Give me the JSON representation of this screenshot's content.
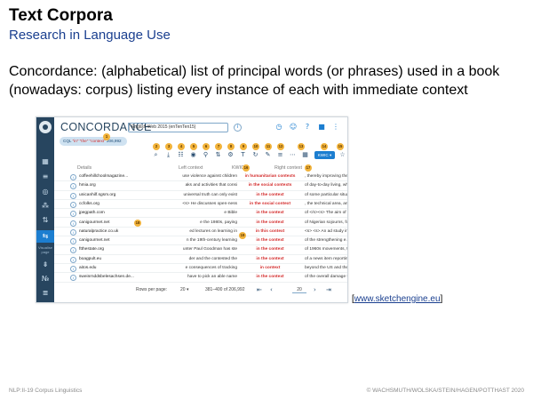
{
  "slide": {
    "title": "Text Corpora",
    "subtitle": "Research in Language Use",
    "body": "Concordance: (alphabetical) list of principal words (or phrases) used in a book (nowadays: corpus) listing every instance of each with immediate context",
    "source_link": "www.sketchengine.eu",
    "footer_left": "NLP:II-19    Corpus Linguistics",
    "footer_right": "© WACHSMUTH/WOLSKA/STEIN/HAGEN/POTTHAST 2020"
  },
  "app": {
    "title": "CONCORDANCE",
    "corpus_selector": "English Web 2015 (enTenTen15)",
    "query_chip_prefix": "CQL",
    "query_chip_term": "\"in\" \"the\" \"context\"",
    "query_chip_count": "206,992",
    "kwic_button": "KWIC",
    "headers": {
      "details": "Details",
      "left": "Left context",
      "kwic": "KWIC",
      "right": "Right context"
    },
    "rows": [
      {
        "num": "",
        "details": "coffeehillchoolmagazine...",
        "left": "use violence against children",
        "kwic": "in humanitarian contexts",
        "right": ", thereby improving the physic"
      },
      {
        "num": "",
        "details": "hmia.org",
        "left": "aks and activities that consi",
        "kwic": "in the social contexts",
        "right": "of day-to-day living, whether"
      },
      {
        "num": "",
        "details": "unicanhilf.sgsm.org",
        "left": "universal truth can only exist",
        "kwic": "in the context",
        "right": "of some particular situation"
      },
      {
        "num": "",
        "details": "ccfolks.org",
        "left": "<s> He discusses open-ness",
        "kwic": "in the social context",
        "right": ", the technical area, and educ"
      },
      {
        "num": "",
        "details": "jpegpath.com",
        "left": "e Bible",
        "kwic": "in the context",
        "right": "of </s><s> The aim of this"
      },
      {
        "num": "",
        "details": "canigourmet.net",
        "left": "e the 1980s, paying",
        "kwic": "in the context",
        "right": "of Nigerian sojourns, fo"
      },
      {
        "num": "",
        "details": "naturalpractice.co.uk",
        "left": "ed lectures on learning in",
        "kwic": "in this context",
        "right": "<s> <s> An ad study in ine"
      },
      {
        "num": "",
        "details": "canigourmet.net",
        "left": "n the 19th-century learning",
        "kwic": "in the context",
        "right": "of the strengthening e.e. sole"
      },
      {
        "num": "",
        "details": "ftthestate.org",
        "left": "unter Paul Goodman has ste",
        "kwic": "in the context",
        "right": "of 1960s movements, the m"
      },
      {
        "num": "",
        "details": "boagpult.eu",
        "left": "der and the contested the",
        "kwic": "in the context",
        "right": "of a news item reporting on"
      },
      {
        "num": "",
        "details": "aitos.edu",
        "left": "e consequences of tracking",
        "kwic": "in context",
        "right": "beyond the US and the UK pl"
      },
      {
        "num": "",
        "details": "sweinrnddsbelesachsen.de...",
        "left": "have to pick  an able name",
        "kwic": "in the context",
        "right": "of the overall damage that's"
      }
    ],
    "pager": {
      "rows_label": "Rows per page:",
      "rows_value": "20",
      "range": "381–400 of 206,992",
      "page": "20"
    },
    "side_label": "Visualise page",
    "icons": {
      "sidebar": [
        "logo-icon",
        "dashboard-icon",
        "list-icon",
        "target-icon",
        "network-icon",
        "sort-icon",
        "concordance-icon",
        "filter-icon",
        "wordlist-icon",
        "ngram-icon"
      ],
      "toolbar": [
        "search-icon",
        "download-icon",
        "bookmark-icon",
        "eye-icon",
        "filter-icon",
        "sort-icon",
        "gear-icon",
        "text-icon",
        "frequency-icon",
        "collocation-icon",
        "lines-icon",
        "more-icon"
      ]
    },
    "badges": [
      "1",
      "2",
      "3",
      "4",
      "5",
      "6",
      "7",
      "8",
      "9",
      "10",
      "11",
      "12",
      "13",
      "14",
      "15",
      "16",
      "17",
      "18",
      "19",
      "20"
    ],
    "colors": {
      "sidebar": "#27455f",
      "accent": "#1c7ed0",
      "kwic": "#d32b2b",
      "badge": "#f2b33a"
    }
  }
}
